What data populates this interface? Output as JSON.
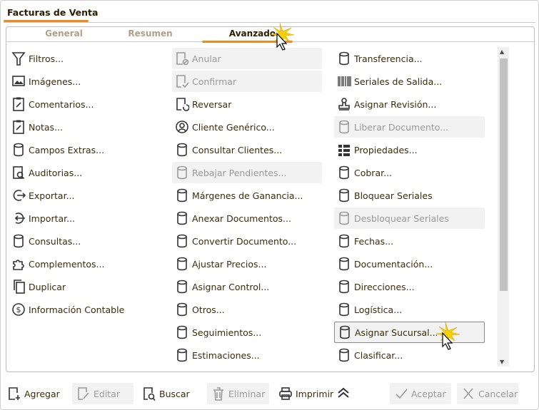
{
  "window": {
    "title": "Facturas de Venta"
  },
  "tabs": [
    {
      "label": "General"
    },
    {
      "label": "Resumen"
    },
    {
      "label": "Avanzado",
      "active": true
    }
  ],
  "columns": [
    [
      {
        "label": "Filtros...",
        "icon": "filter-icon"
      },
      {
        "label": "Imágenes...",
        "icon": "image-icon"
      },
      {
        "label": "Comentarios...",
        "icon": "clipboard-edit-icon"
      },
      {
        "label": "Notas...",
        "icon": "clipboard-edit-icon"
      },
      {
        "label": "Campos Extras...",
        "icon": "database-icon"
      },
      {
        "label": "Auditorias...",
        "icon": "audit-icon"
      },
      {
        "label": "Exportar...",
        "icon": "export-icon"
      },
      {
        "label": "Importar...",
        "icon": "import-icon"
      },
      {
        "label": "Consultas...",
        "icon": "database-icon"
      },
      {
        "label": "Complementos...",
        "icon": "puzzle-icon"
      },
      {
        "label": "Duplicar",
        "icon": "copy-icon"
      },
      {
        "label": "Información Contable",
        "icon": "dollar-icon"
      }
    ],
    [
      {
        "label": "Anular",
        "icon": "document-cancel-icon",
        "disabled": true
      },
      {
        "label": "Confirmar",
        "icon": "document-check-icon",
        "disabled": true
      },
      {
        "label": "Reversar",
        "icon": "document-undo-icon"
      },
      {
        "label": "Cliente Genérico...",
        "icon": "user-circle-icon"
      },
      {
        "label": "Consultar Clientes...",
        "icon": "database-icon"
      },
      {
        "label": "Rebajar Pendientes...",
        "icon": "database-icon",
        "disabled": true
      },
      {
        "label": "Márgenes de Ganancia...",
        "icon": "database-icon"
      },
      {
        "label": "Anexar Documentos...",
        "icon": "database-icon"
      },
      {
        "label": "Convertir Documento...",
        "icon": "database-icon"
      },
      {
        "label": "Ajustar Precios...",
        "icon": "database-icon"
      },
      {
        "label": "Asignar Control...",
        "icon": "database-icon"
      },
      {
        "label": "Otros...",
        "icon": "database-icon"
      },
      {
        "label": "Seguimientos...",
        "icon": "database-icon"
      },
      {
        "label": "Estimaciones...",
        "icon": "database-icon"
      }
    ],
    [
      {
        "label": "Transferencia...",
        "icon": "database-icon"
      },
      {
        "label": "Seriales de Salida...",
        "icon": "barcode-icon"
      },
      {
        "label": "Asignar Revisión...",
        "icon": "stamp-icon"
      },
      {
        "label": "Liberar Documento...",
        "icon": "database-icon",
        "disabled": true
      },
      {
        "label": "Propiedades...",
        "icon": "properties-icon"
      },
      {
        "label": "Cobrar...",
        "icon": "database-icon"
      },
      {
        "label": "Bloquear Seriales",
        "icon": "database-icon"
      },
      {
        "label": "Desbloquear Seriales",
        "icon": "database-icon",
        "disabled": true
      },
      {
        "label": "Fechas...",
        "icon": "database-icon"
      },
      {
        "label": "Documentación...",
        "icon": "database-icon"
      },
      {
        "label": "Direcciones...",
        "icon": "database-icon"
      },
      {
        "label": "Logística...",
        "icon": "database-icon"
      },
      {
        "label": "Asignar Sucursal...",
        "icon": "database-icon",
        "hover": true
      },
      {
        "label": "Clasificar...",
        "icon": "database-icon"
      }
    ]
  ],
  "toolbar": [
    {
      "label": "Agregar",
      "icon": "add-document-icon"
    },
    {
      "label": "Editar",
      "icon": "edit-document-icon",
      "disabled": true
    },
    {
      "label": "Buscar",
      "icon": "search-document-icon"
    },
    {
      "label": "Eliminar",
      "icon": "trash-icon",
      "disabled": true
    },
    {
      "label": "Imprimir",
      "icon": "printer-icon"
    },
    {
      "label": "Aceptar",
      "icon": "check-icon",
      "disabled": true
    },
    {
      "label": "Cancelar",
      "icon": "close-icon",
      "disabled": true
    }
  ],
  "colors": {
    "accent": "#f08a1c",
    "text": "#3b2d0a",
    "disabled": "#9a9a9a"
  }
}
